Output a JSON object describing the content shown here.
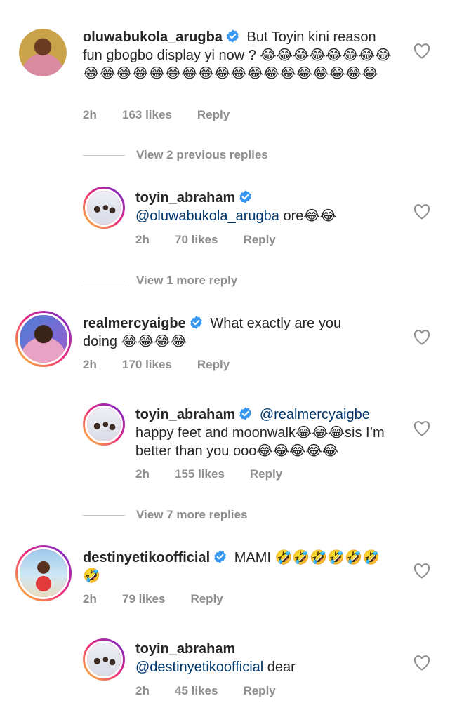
{
  "comments": [
    {
      "username": "oluwabukola_arugba",
      "verified": true,
      "text": "But Toyin kini reason fun gbogbo display yi now ? 😂😂😂😂😂😂😂😂😂😂😂😂😂😂😂😂😂😂😂😂😂😂😂😂😂😂",
      "time": "2h",
      "likes": "163 likes",
      "reply": "Reply"
    },
    {
      "view_replies": "View 2 previous replies"
    },
    {
      "username": "toyin_abraham",
      "verified": true,
      "mention": "@oluwabukola_arugba",
      "text": " ore😂😂",
      "time": "2h",
      "likes": "70 likes",
      "reply": "Reply"
    },
    {
      "view_replies": "View 1 more reply"
    },
    {
      "username": "realmercyaigbe",
      "verified": true,
      "text": "What exactly are you doing 😂😂😂😂",
      "time": "2h",
      "likes": "170 likes",
      "reply": "Reply"
    },
    {
      "username": "toyin_abraham",
      "verified": true,
      "mention": "@realmercyaigbe",
      "text": " happy feet and moonwalk😂😂😂sis I’m better than you ooo😂😂😂😂😂",
      "time": "2h",
      "likes": "155 likes",
      "reply": "Reply"
    },
    {
      "view_replies": "View 7 more replies"
    },
    {
      "username": "destinyetikoofficial",
      "verified": true,
      "text": "MAMI 🤣🤣🤣🤣🤣🤣🤣",
      "time": "2h",
      "likes": "79 likes",
      "reply": "Reply"
    },
    {
      "username": "toyin_abraham",
      "verified": false,
      "mention": "@destinyetikoofficial",
      "text": " dear",
      "time": "2h",
      "likes": "45 likes",
      "reply": "Reply"
    }
  ],
  "icons": {
    "verified": "verified-badge-icon",
    "like": "heart-outline-icon"
  },
  "colors": {
    "verified": "#3897f0",
    "mention": "#00376b",
    "meta": "#8e8e8e"
  }
}
